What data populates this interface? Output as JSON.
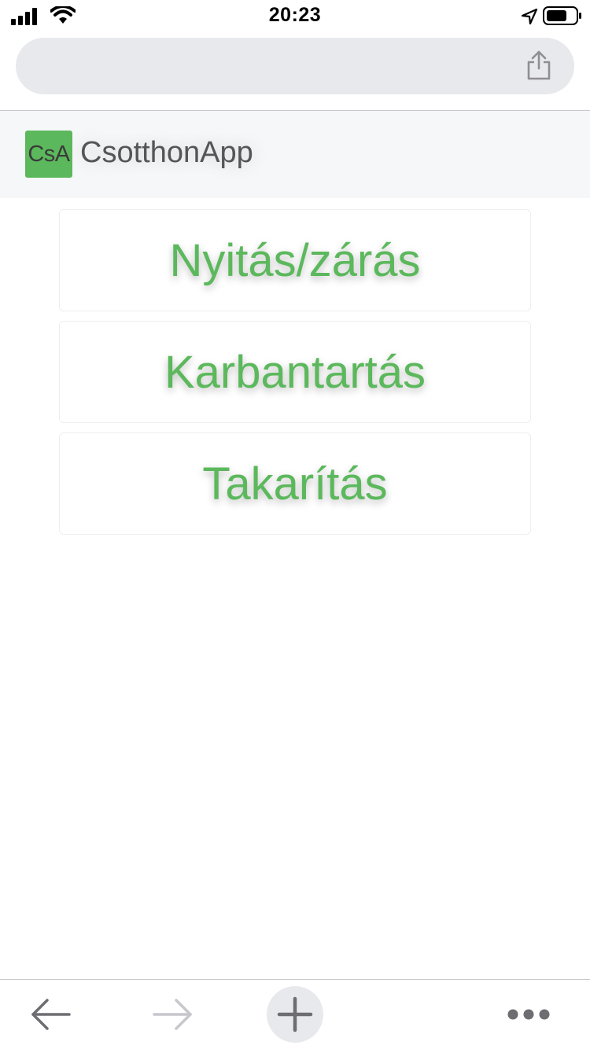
{
  "status_bar": {
    "time": "20:23",
    "icons": [
      "signal-icon",
      "wifi-icon",
      "location-arrow-icon",
      "battery-icon"
    ]
  },
  "browser": {
    "address_value": "",
    "share_icon": "share-icon"
  },
  "app_header": {
    "logo_text": "CsA",
    "brand_name": "CsotthonApp",
    "logo_color": "#5cb85c"
  },
  "menu": {
    "items": [
      {
        "label": "Nyitás/zárás"
      },
      {
        "label": "Karbantartás"
      },
      {
        "label": "Takarítás"
      }
    ],
    "accent_color": "#5cb85c"
  },
  "toolbar": {
    "icons": [
      "back-arrow-icon",
      "forward-arrow-icon",
      "plus-icon",
      "more-dots-icon"
    ]
  }
}
